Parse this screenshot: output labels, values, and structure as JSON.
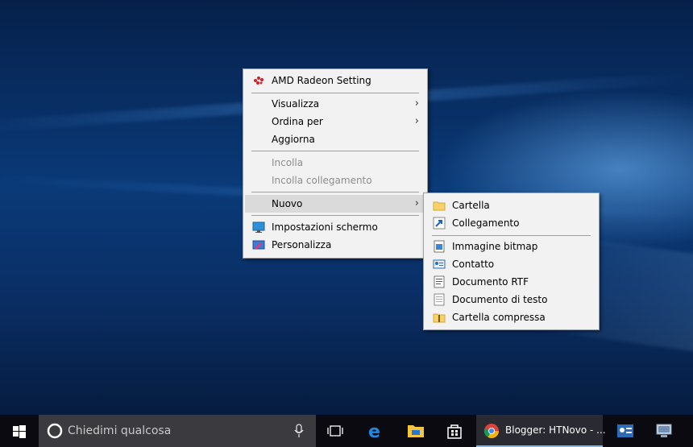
{
  "main_menu": {
    "items": [
      {
        "label": "AMD Radeon Setting",
        "icon": "amd-radeon-icon"
      },
      {
        "label": "Visualizza",
        "submenu": true
      },
      {
        "label": "Ordina per",
        "submenu": true
      },
      {
        "label": "Aggiorna"
      },
      {
        "label": "Incolla",
        "disabled": true
      },
      {
        "label": "Incolla collegamento",
        "disabled": true
      },
      {
        "label": "Nuovo",
        "submenu": true,
        "highlighted": true
      },
      {
        "label": "Impostazioni schermo",
        "icon": "display-settings-icon"
      },
      {
        "label": "Personalizza",
        "icon": "personalize-icon"
      }
    ]
  },
  "sub_menu": {
    "items": [
      {
        "label": "Cartella",
        "icon": "folder-icon"
      },
      {
        "label": "Collegamento",
        "icon": "shortcut-icon"
      },
      {
        "label": "Immagine bitmap",
        "icon": "bitmap-icon"
      },
      {
        "label": "Contatto",
        "icon": "contact-icon"
      },
      {
        "label": "Documento RTF",
        "icon": "rtf-document-icon"
      },
      {
        "label": "Documento di testo",
        "icon": "text-document-icon"
      },
      {
        "label": "Cartella compressa",
        "icon": "zip-folder-icon"
      }
    ]
  },
  "taskbar": {
    "search_placeholder": "Chiedimi qualcosa",
    "chrome_window_title": "Blogger: HTNovo - ...",
    "icons": [
      "windows-start-icon",
      "cortana-icon",
      "microphone-icon",
      "task-view-icon",
      "edge-icon",
      "file-explorer-icon",
      "store-icon",
      "chrome-icon",
      "contacts-app-icon",
      "computer-app-icon"
    ]
  },
  "colors": {
    "menu_background": "#f2f2f2",
    "highlight": "#dadada",
    "taskbar": "#0a0a10",
    "search_box": "#3a3a3f",
    "active_underline": "#76b9ed"
  }
}
